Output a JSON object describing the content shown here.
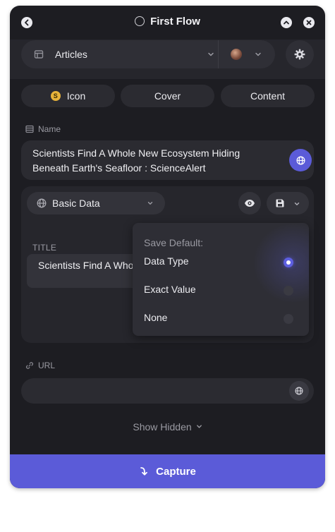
{
  "window": {
    "title": "First Flow"
  },
  "database": {
    "name": "Articles"
  },
  "tabs": [
    {
      "label": "Icon",
      "icon_badge": "S"
    },
    {
      "label": "Cover"
    },
    {
      "label": "Content"
    }
  ],
  "name_field": {
    "label": "Name",
    "value": "Scientists Find A Whole New Ecosystem Hiding Beneath Earth's Seafloor : ScienceAlert"
  },
  "property_group": {
    "selected": "Basic Data"
  },
  "title_field": {
    "label": "TITLE",
    "value": "Scientists Find A Whole New Ecosystem Hiding Beneath Earth's Seafloor : ScienceAlert"
  },
  "save_default_menu": {
    "header": "Save Default:",
    "options": [
      {
        "label": "Data Type",
        "selected": true
      },
      {
        "label": "Exact Value",
        "selected": false
      },
      {
        "label": "None",
        "selected": false
      }
    ]
  },
  "url_field": {
    "label": "URL",
    "value": ""
  },
  "show_hidden_label": "Show Hidden",
  "capture_label": "Capture",
  "colors": {
    "accent": "#5b5bd8",
    "background": "#1d1d22",
    "surface": "#2b2b31"
  },
  "icons": [
    "back-icon",
    "status-circle-icon",
    "collapse-icon",
    "close-icon",
    "database-icon",
    "chevron-down-icon",
    "avatar",
    "gear-icon",
    "coin-icon",
    "name-field-icon",
    "globe-icon",
    "eye-icon",
    "save-icon",
    "link-icon",
    "capture-icon"
  ]
}
